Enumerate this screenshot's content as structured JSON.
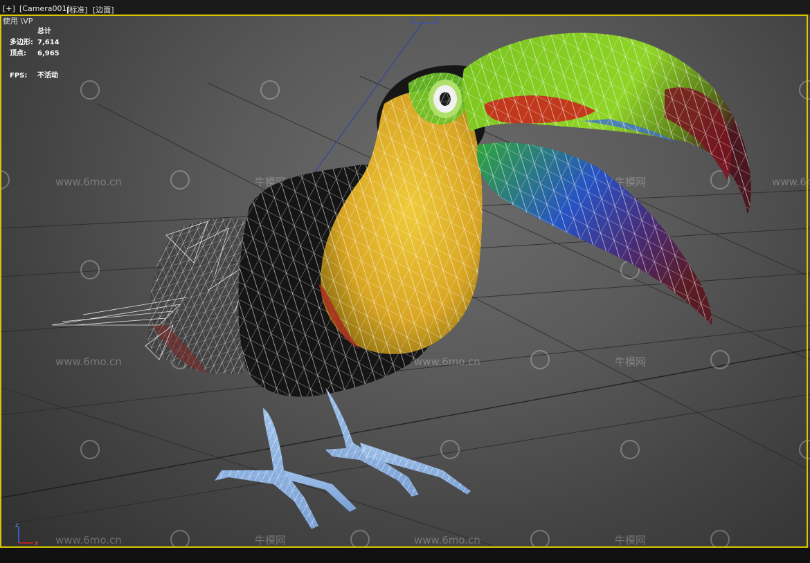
{
  "viewport_label": {
    "plus": "[+]",
    "camera": "[Camera001]",
    "mode": "[标准]",
    "shading": "[边面]"
  },
  "shading_info": "使用 \\VP",
  "stats": {
    "header": "总计",
    "polygons_label": "多边形:",
    "polygons_value": "7,614",
    "vertices_label": "顶点:",
    "vertices_value": "6,965",
    "fps_label": "FPS:",
    "fps_value": "不活动"
  },
  "watermarks": {
    "site": "www.6mo.cn",
    "brand": "牛模网"
  },
  "axis": {
    "x": "x",
    "z": "z"
  },
  "colors": {
    "viewport_border": "#d8c800",
    "beak_green": "#7ec81e",
    "beak_red": "#c8281c",
    "beak_blue": "#2e5fc8",
    "chest_yellow": "#e2bb2a",
    "feet_blue": "#8fb3e0"
  }
}
